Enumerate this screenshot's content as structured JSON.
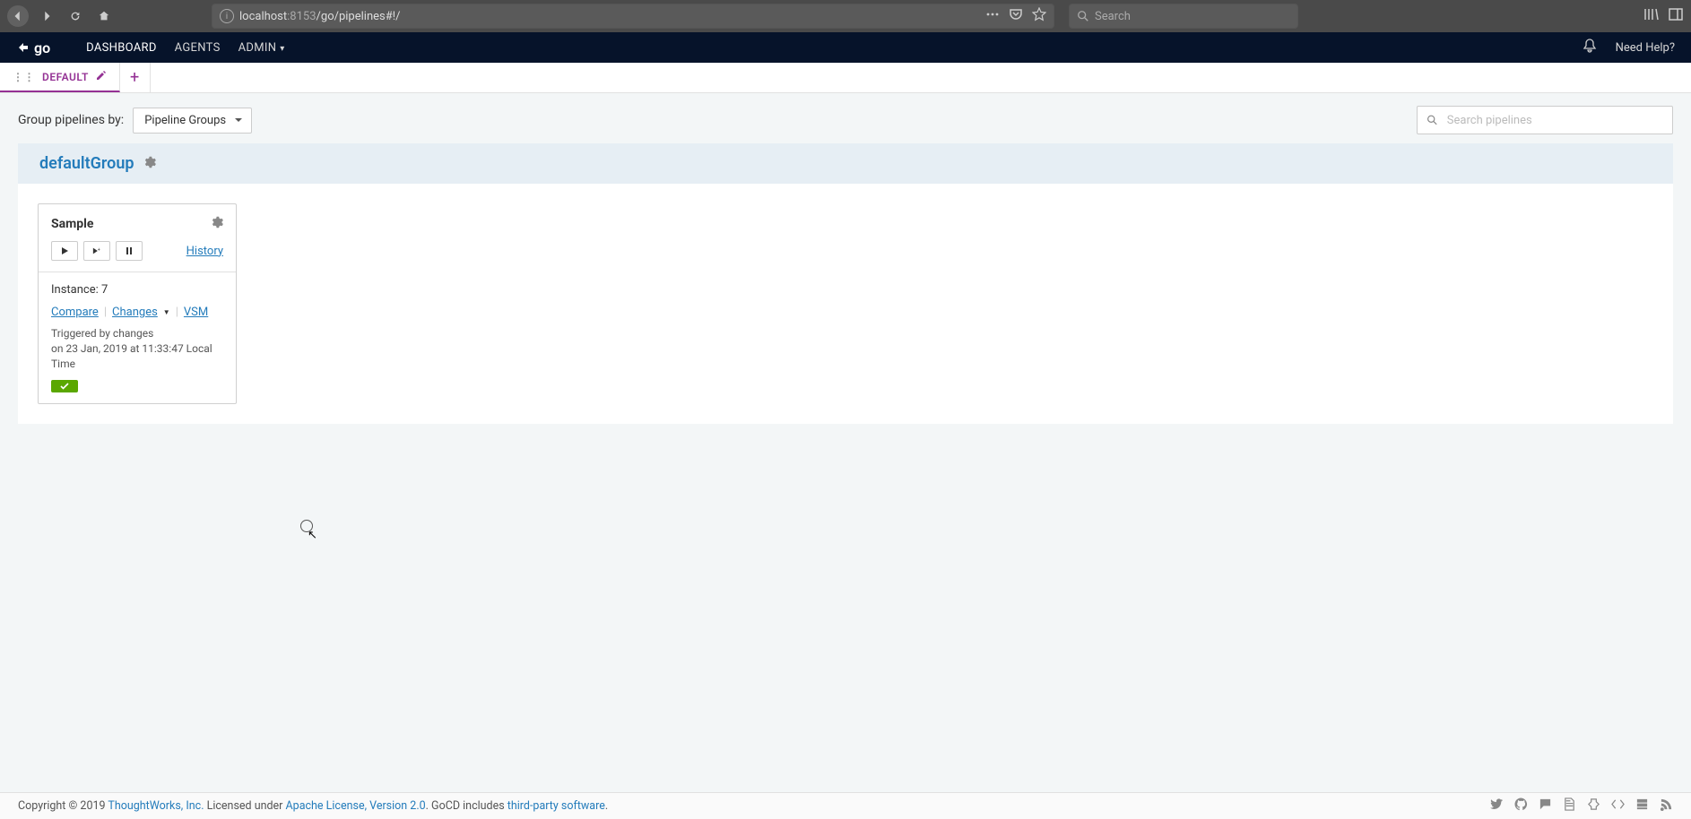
{
  "browser": {
    "url_host": "localhost",
    "url_port": ":8153",
    "url_path": "/go/pipelines#!/",
    "search_placeholder": "Search"
  },
  "nav": {
    "dashboard": "DASHBOARD",
    "agents": "AGENTS",
    "admin": "ADMIN",
    "help": "Need Help?"
  },
  "tabs": {
    "default": "DEFAULT"
  },
  "toolbar": {
    "group_label": "Group pipelines by:",
    "group_value": "Pipeline Groups",
    "search_placeholder": "Search pipelines"
  },
  "group": {
    "name": "defaultGroup"
  },
  "pipeline": {
    "name": "Sample",
    "history": "History",
    "instance_label": "Instance: 7",
    "compare": "Compare",
    "changes": "Changes",
    "vsm": "VSM",
    "triggered_by": "Triggered by changes",
    "triggered_on": "on 23 Jan, 2019 at 11:33:47 Local Time"
  },
  "footer": {
    "copyright_pre": "Copyright © 2019 ",
    "thoughtworks": "ThoughtWorks, Inc.",
    "licensed": " Licensed under ",
    "apache": "Apache License, Version 2.0",
    "gocd_includes": ". GoCD includes ",
    "third_party": "third-party software",
    "period": "."
  }
}
